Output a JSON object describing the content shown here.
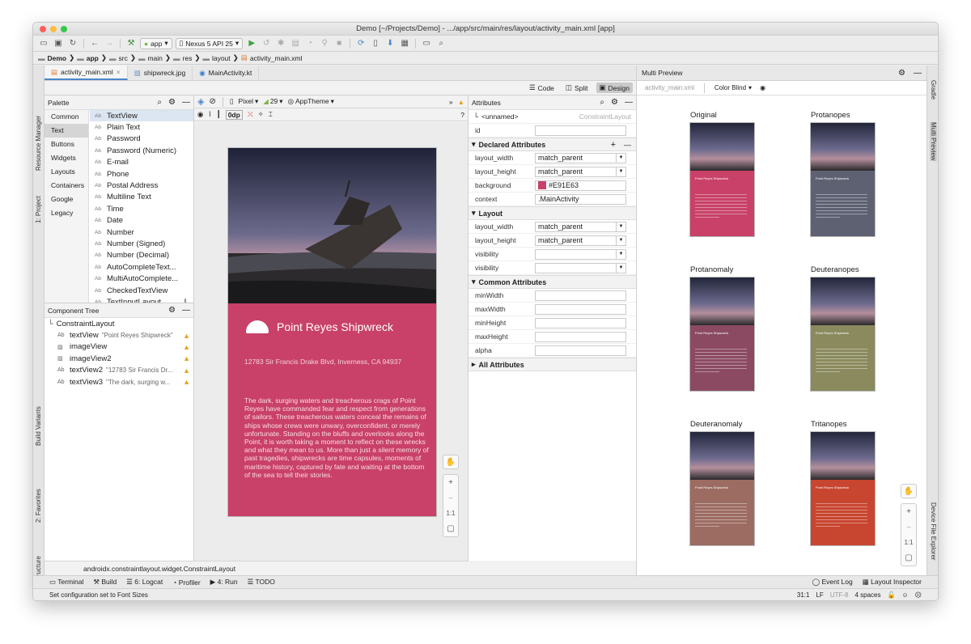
{
  "window": {
    "title": "Demo [~/Projects/Demo] - .../app/src/main/res/layout/activity_main.xml [app]"
  },
  "toolbar": {
    "config": "app",
    "device": "Nexus 5 API 25"
  },
  "breadcrumbs": [
    "Demo",
    "app",
    "src",
    "main",
    "res",
    "layout",
    "activity_main.xml"
  ],
  "tabs": [
    {
      "label": "activity_main.xml"
    },
    {
      "label": "shipwreck.jpg"
    },
    {
      "label": "MainActivity.kt"
    }
  ],
  "view_modes": {
    "code": "Code",
    "split": "Split",
    "design": "Design"
  },
  "palette": {
    "title": "Palette",
    "categories": [
      "Common",
      "Text",
      "Buttons",
      "Widgets",
      "Layouts",
      "Containers",
      "Google",
      "Legacy"
    ],
    "items": [
      "TextView",
      "Plain Text",
      "Password",
      "Password (Numeric)",
      "E-mail",
      "Phone",
      "Postal Address",
      "Multiline Text",
      "Time",
      "Date",
      "Number",
      "Number (Signed)",
      "Number (Decimal)",
      "AutoCompleteText...",
      "MultiAutoComplete...",
      "CheckedTextView",
      "TextInputLayout"
    ]
  },
  "component_tree": {
    "title": "Component Tree",
    "root": "ConstraintLayout",
    "rows": [
      {
        "name": "textView",
        "detail": "\"Point Reyes Shipwreck\""
      },
      {
        "name": "imageView",
        "detail": ""
      },
      {
        "name": "imageView2",
        "detail": ""
      },
      {
        "name": "textView2",
        "detail": "\"12783 Sir Francis Dr..."
      },
      {
        "name": "textView3",
        "detail": "\"The dark, surging w..."
      }
    ]
  },
  "design_toolbar": {
    "device": "Pixel",
    "api": "29",
    "theme": "AppTheme",
    "margin": "0dp"
  },
  "phone": {
    "title": "Point Reyes Shipwreck",
    "address": "12783 Sir Francis Drake Blvd, Inverness, CA 94937",
    "body": "The dark, surging waters and treacherous crags of Point Reyes have commanded fear and respect from generations of sailors. These treacherous waters conceal the remains of ships whose crews were unwary, overconfident, or merely unfortunate. Standing on the bluffs and overlooks along the Point, it is worth taking a moment to reflect on these wrecks and what they mean to us. More than just a silent memory of past tragedies, shipwrecks are time capsules, moments of maritime history, captured by fate and waiting at the bottom of the sea to tell their stories.",
    "bg_color": "#C94168"
  },
  "zoom": {
    "ratio": "1:1"
  },
  "attributes": {
    "title": "Attributes",
    "unnamed": "<unnamed>",
    "class": "ConstraintLayout",
    "id_label": "id",
    "declared_title": "Declared Attributes",
    "declared": [
      {
        "key": "layout_width",
        "value": "match_parent"
      },
      {
        "key": "layout_height",
        "value": "match_parent"
      },
      {
        "key": "background",
        "value": "#E91E63"
      },
      {
        "key": "context",
        "value": ".MainActivity"
      }
    ],
    "layout_title": "Layout",
    "layout": [
      {
        "key": "layout_width",
        "value": "match_parent"
      },
      {
        "key": "layout_height",
        "value": "match_parent"
      },
      {
        "key": "visibility",
        "value": ""
      },
      {
        "key": "visibility",
        "value": ""
      }
    ],
    "common_title": "Common Attributes",
    "common": [
      "minWidth",
      "maxWidth",
      "minHeight",
      "maxHeight",
      "alpha"
    ],
    "all_title": "All Attributes"
  },
  "status_path": "androidx.constraintlayout.widget.ConstraintLayout",
  "preview": {
    "title": "Multi Preview",
    "file": "activity_main.xml",
    "mode": "Color Blind",
    "items": [
      {
        "label": "Original",
        "color": "#C94168"
      },
      {
        "label": "Protanopes",
        "color": "#5E6172"
      },
      {
        "label": "Protanomaly",
        "color": "#8B4A62"
      },
      {
        "label": "Deuteranopes",
        "color": "#8A8A5E"
      },
      {
        "label": "Deuteranomaly",
        "color": "#9C6B62"
      },
      {
        "label": "Tritanopes",
        "color": "#C8452F"
      }
    ],
    "zoom": "1:1"
  },
  "left_tools": [
    "Resource Manager",
    "1: Project",
    "Build Variants",
    "2: Favorites",
    "Z: Structure"
  ],
  "right_tools": [
    "Gradle",
    "Multi Preview",
    "Device File Explorer"
  ],
  "bottom_tools": [
    "Terminal",
    "Build",
    "6: Logcat",
    "Profiler",
    "4: Run",
    "TODO"
  ],
  "bottom_right_tools": [
    "Event Log",
    "Layout Inspector"
  ],
  "statusbar": {
    "message": "Set configuration set to Font Sizes",
    "position": "31:1",
    "line_sep": "LF",
    "encoding": "UTF-8",
    "indent": "4 spaces"
  }
}
